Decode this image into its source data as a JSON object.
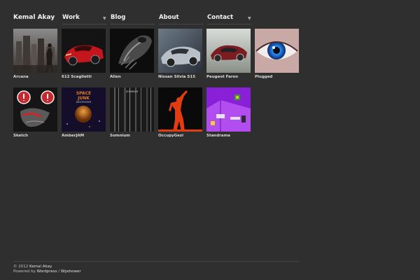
{
  "nav": {
    "brand": "Kemal Akay",
    "items": [
      {
        "label": "Work",
        "has_dropdown": true
      },
      {
        "label": "Blog",
        "has_dropdown": false
      },
      {
        "label": "About",
        "has_dropdown": false
      },
      {
        "label": "Contact",
        "has_dropdown": true
      }
    ]
  },
  "portfolio": [
    {
      "title": "Arcana",
      "icon": "city-figure-thumbnail"
    },
    {
      "title": "612 Scaglietti",
      "icon": "red-car-thumbnail"
    },
    {
      "title": "Alien",
      "icon": "alien-head-thumbnail"
    },
    {
      "title": "Nissan Silvia S15",
      "icon": "silver-car-thumbnail"
    },
    {
      "title": "Peugeot Faron",
      "icon": "concept-car-thumbnail"
    },
    {
      "title": "Plugged",
      "icon": "blue-eye-thumbnail"
    },
    {
      "title": "Sketch",
      "icon": "sketch-face-thumbnail"
    },
    {
      "title": "AmberJAM",
      "icon": "space-junk-thumbnail"
    },
    {
      "title": "Somnium",
      "icon": "somnium-thumbnail"
    },
    {
      "title": "OccupyGezi",
      "icon": "raised-fist-figure-thumbnail"
    },
    {
      "title": "Standrama",
      "icon": "purple-room-thumbnail"
    }
  ],
  "thumb_text": {
    "space_junk": [
      "SPACE",
      "JUNK",
      "DESTROYER"
    ],
    "somnium": "SOMNIUM"
  },
  "footer": {
    "copyright": "© 2012",
    "owner": "Kemal Akay",
    "powered_by": "Powered by",
    "cms": "Wordpress",
    "separator": "/",
    "theme": "Wpshower"
  },
  "colors": {
    "background": "#2f2f2f",
    "text": "#e8e8e8",
    "divider": "#4a4a4a"
  }
}
